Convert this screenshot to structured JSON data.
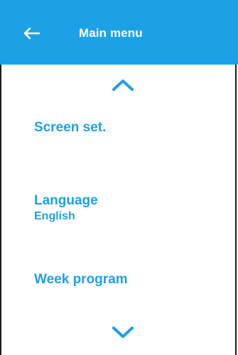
{
  "header": {
    "title": "Main menu",
    "back_icon": "arrow-left-icon"
  },
  "navigation": {
    "up_icon": "chevron-up-icon",
    "down_icon": "chevron-down-icon"
  },
  "menu": {
    "items": [
      {
        "label": "Screen set.",
        "value": ""
      },
      {
        "label": "Language",
        "value": "English"
      },
      {
        "label": "Week program",
        "value": ""
      }
    ]
  },
  "colors": {
    "accent": "#1da1e6",
    "header_text": "#ffffff",
    "border": "#1a1a1a"
  }
}
